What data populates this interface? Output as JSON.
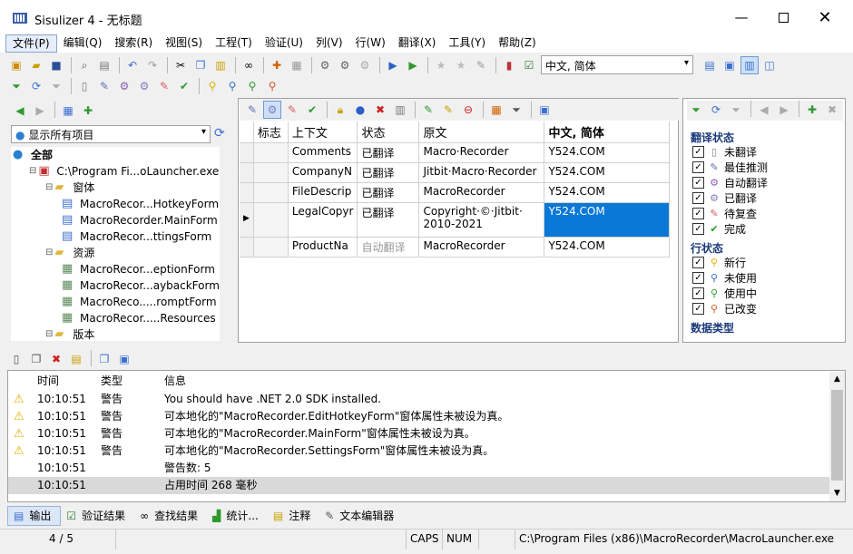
{
  "window": {
    "title": "Sisulizer 4 - 无标题"
  },
  "menu": [
    "文件(P)",
    "编辑(Q)",
    "搜索(R)",
    "视图(S)",
    "工程(T)",
    "验证(U)",
    "列(V)",
    "行(W)",
    "翻译(X)",
    "工具(Y)",
    "帮助(Z)"
  ],
  "toolbar": {
    "language_combo": "中文, 简体"
  },
  "left": {
    "filter": "显示所有项目",
    "tree": [
      {
        "label": "全部",
        "level": 0,
        "icon": "globe-icon",
        "bold": true
      },
      {
        "label": "C:\\Program Fi...oLauncher.exe",
        "level": 1,
        "icon": "exe-icon"
      },
      {
        "label": "窗体",
        "level": 2,
        "icon": "folder-icon"
      },
      {
        "label": "MacroRecor...HotkeyForm",
        "level": 3,
        "icon": "form-icon"
      },
      {
        "label": "MacroRecorder.MainForm",
        "level": 3,
        "icon": "form-icon"
      },
      {
        "label": "MacroRecor...ttingsForm",
        "level": 3,
        "icon": "form-icon"
      },
      {
        "label": "资源",
        "level": 2,
        "icon": "folder-icon"
      },
      {
        "label": "MacroRecor...eptionForm",
        "level": 3,
        "icon": "resource-icon"
      },
      {
        "label": "MacroRecor...aybackForm",
        "level": 3,
        "icon": "resource-icon"
      },
      {
        "label": "MacroReco.....romptForm",
        "level": 3,
        "icon": "resource-icon"
      },
      {
        "label": "MacroRecor.....Resources",
        "level": 3,
        "icon": "resource-icon"
      },
      {
        "label": "版本",
        "level": 2,
        "icon": "folder-icon"
      }
    ]
  },
  "grid": {
    "headers": [
      "标志",
      "上下文",
      "状态",
      "原文",
      "中文, 简体"
    ],
    "rows": [
      {
        "context": "Comments",
        "status": "已翻译",
        "source": "Macro·Recorder",
        "target": "Y524.COM"
      },
      {
        "context": "CompanyN",
        "status": "已翻译",
        "source": "Jitbit·Macro·Recorder",
        "target": "Y524.COM"
      },
      {
        "context": "FileDescrip",
        "status": "已翻译",
        "source": "MacroRecorder",
        "target": "Y524.COM"
      },
      {
        "context": "LegalCopyr",
        "status": "已翻译",
        "source": "Copyright·©·Jitbit·\n2010-2021",
        "target": "Y524.COM"
      },
      {
        "context": "ProductNa",
        "status": "自动翻译",
        "source": "MacroRecorder",
        "target": "Y524.COM"
      }
    ]
  },
  "right": {
    "sections": [
      {
        "title": "翻译状态",
        "items": [
          {
            "label": "未翻译",
            "icon": "page-icon",
            "color": "#7f7f7f"
          },
          {
            "label": "最佳推测",
            "icon": "guess-icon",
            "color": "#5b6fb5"
          },
          {
            "label": "自动翻译",
            "icon": "auto-icon",
            "color": "#8f5fb5"
          },
          {
            "label": "已翻译",
            "icon": "gear-icon",
            "color": "#7f7fbf"
          },
          {
            "label": "待复查",
            "icon": "review-icon",
            "color": "#d95b5b"
          },
          {
            "label": "完成",
            "icon": "check-icon",
            "color": "#2e9a2e"
          }
        ]
      },
      {
        "title": "行状态",
        "items": [
          {
            "label": "新行",
            "icon": "pin-new-icon",
            "color": "#e0b000"
          },
          {
            "label": "未使用",
            "icon": "pin-unused-icon",
            "color": "#3a6fd0"
          },
          {
            "label": "使用中",
            "icon": "pin-used-icon",
            "color": "#2e9a2e"
          },
          {
            "label": "已改变",
            "icon": "pin-changed-icon",
            "color": "#d05a2a"
          }
        ]
      },
      {
        "title": "数据类型",
        "items": []
      }
    ]
  },
  "output": {
    "headers": [
      "时间",
      "类型",
      "信息"
    ],
    "rows": [
      {
        "time": "10:10:51",
        "type": "警告",
        "msg": "You should have .NET 2.0 SDK installed.",
        "warn": true
      },
      {
        "time": "10:10:51",
        "type": "警告",
        "msg": "可本地化的\"MacroRecorder.EditHotkeyForm\"窗体属性未被设为真。",
        "warn": true
      },
      {
        "time": "10:10:51",
        "type": "警告",
        "msg": "可本地化的\"MacroRecorder.MainForm\"窗体属性未被设为真。",
        "warn": true
      },
      {
        "time": "10:10:51",
        "type": "警告",
        "msg": "可本地化的\"MacroRecorder.SettingsForm\"窗体属性未被设为真。",
        "warn": true
      },
      {
        "time": "10:10:51",
        "type": "",
        "msg": "警告数: 5",
        "warn": false
      },
      {
        "time": "10:10:51",
        "type": "",
        "msg": "占用时间 268 毫秒",
        "warn": false
      }
    ]
  },
  "bottom_tabs": [
    "输出",
    "验证结果",
    "查找结果",
    "统计...",
    "注释",
    "文本编辑器"
  ],
  "status": {
    "position": "4 / 5",
    "caps": "CAPS",
    "num": "NUM",
    "path": "C:\\Program Files (x86)\\MacroRecorder\\MacroLauncher.exe"
  }
}
